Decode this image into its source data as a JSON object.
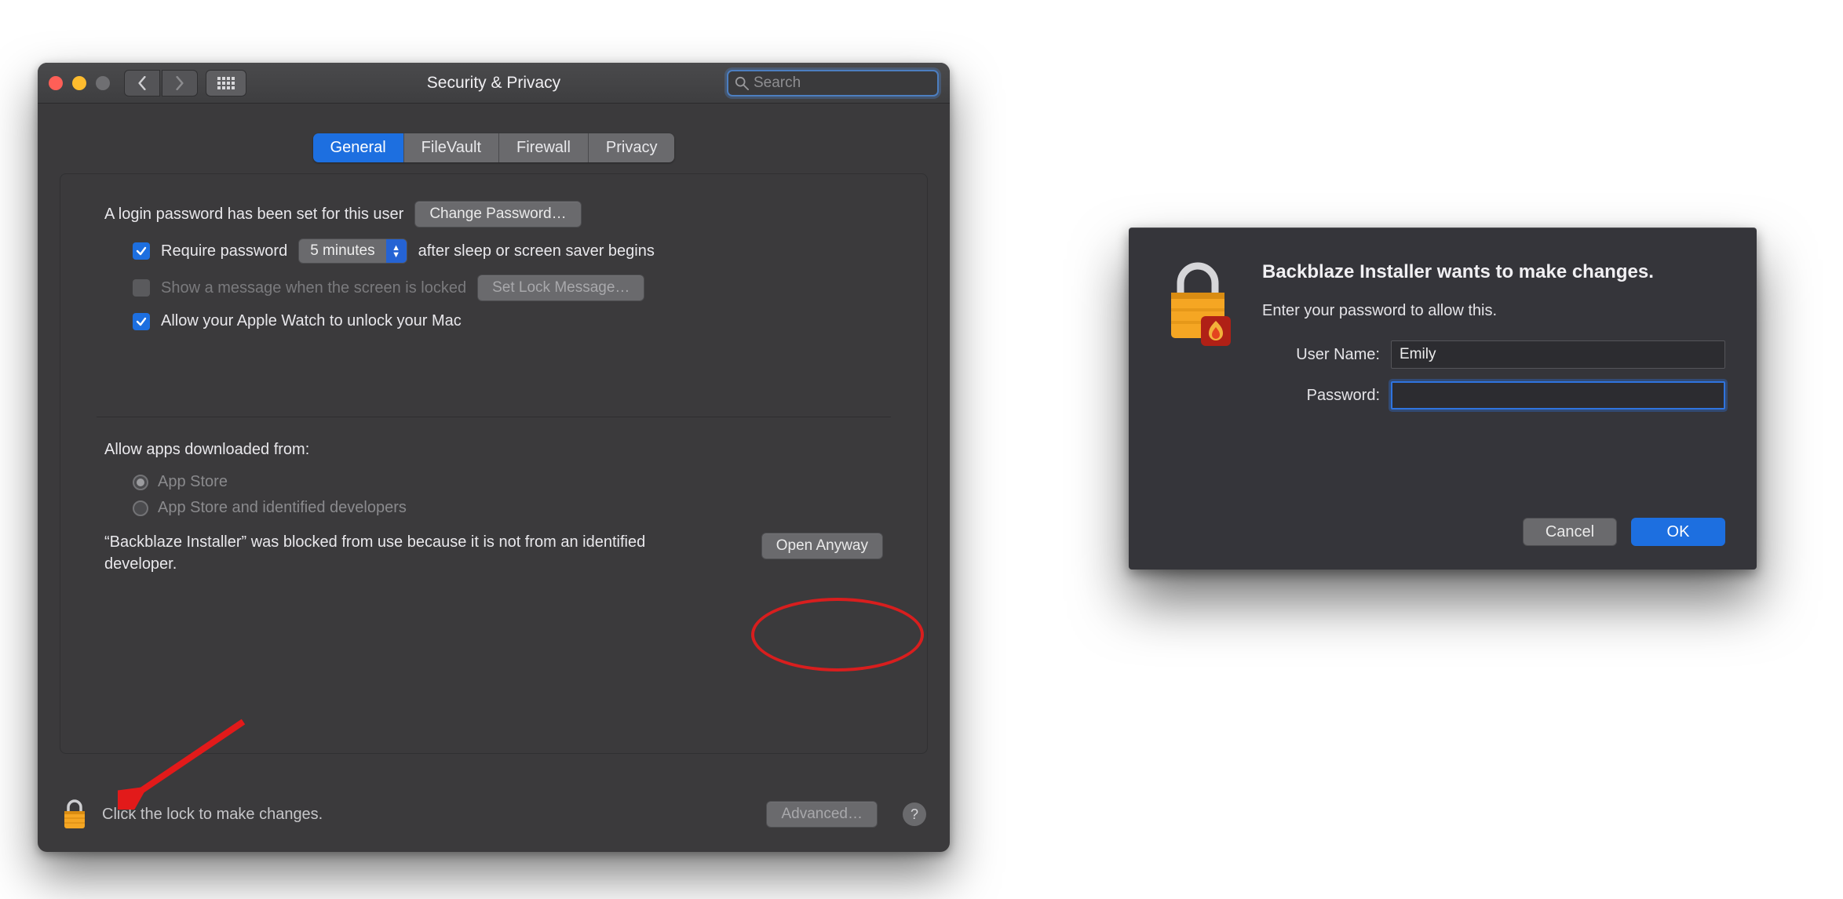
{
  "prefs": {
    "title": "Security & Privacy",
    "search_placeholder": "Search",
    "tabs": {
      "general": "General",
      "filevault": "FileVault",
      "firewall": "Firewall",
      "privacy": "Privacy"
    },
    "login_password_text": "A login password has been set for this user",
    "change_password_btn": "Change Password…",
    "require_password_label": "Require password",
    "require_password_delay": "5 minutes",
    "after_sleep_text": "after sleep or screen saver begins",
    "show_message_label": "Show a message when the screen is locked",
    "set_lock_message_btn": "Set Lock Message…",
    "applewatch_label": "Allow your Apple Watch to unlock your Mac",
    "allow_apps_heading": "Allow apps downloaded from:",
    "radio_appstore": "App Store",
    "radio_identified": "App Store and identified developers",
    "blocked_text": "“Backblaze Installer” was blocked from use because it is not from an identified developer.",
    "open_anyway_btn": "Open Anyway",
    "lock_text": "Click the lock to make changes.",
    "advanced_btn": "Advanced…",
    "help_label": "?"
  },
  "dialog": {
    "title": "Backblaze Installer wants to make changes.",
    "subtitle": "Enter your password to allow this.",
    "username_label": "User Name:",
    "username_value": "Emily",
    "password_label": "Password:",
    "password_value": "",
    "cancel": "Cancel",
    "ok": "OK"
  },
  "colors": {
    "accent": "#1d6fe0",
    "annotation": "#d81e1e"
  }
}
